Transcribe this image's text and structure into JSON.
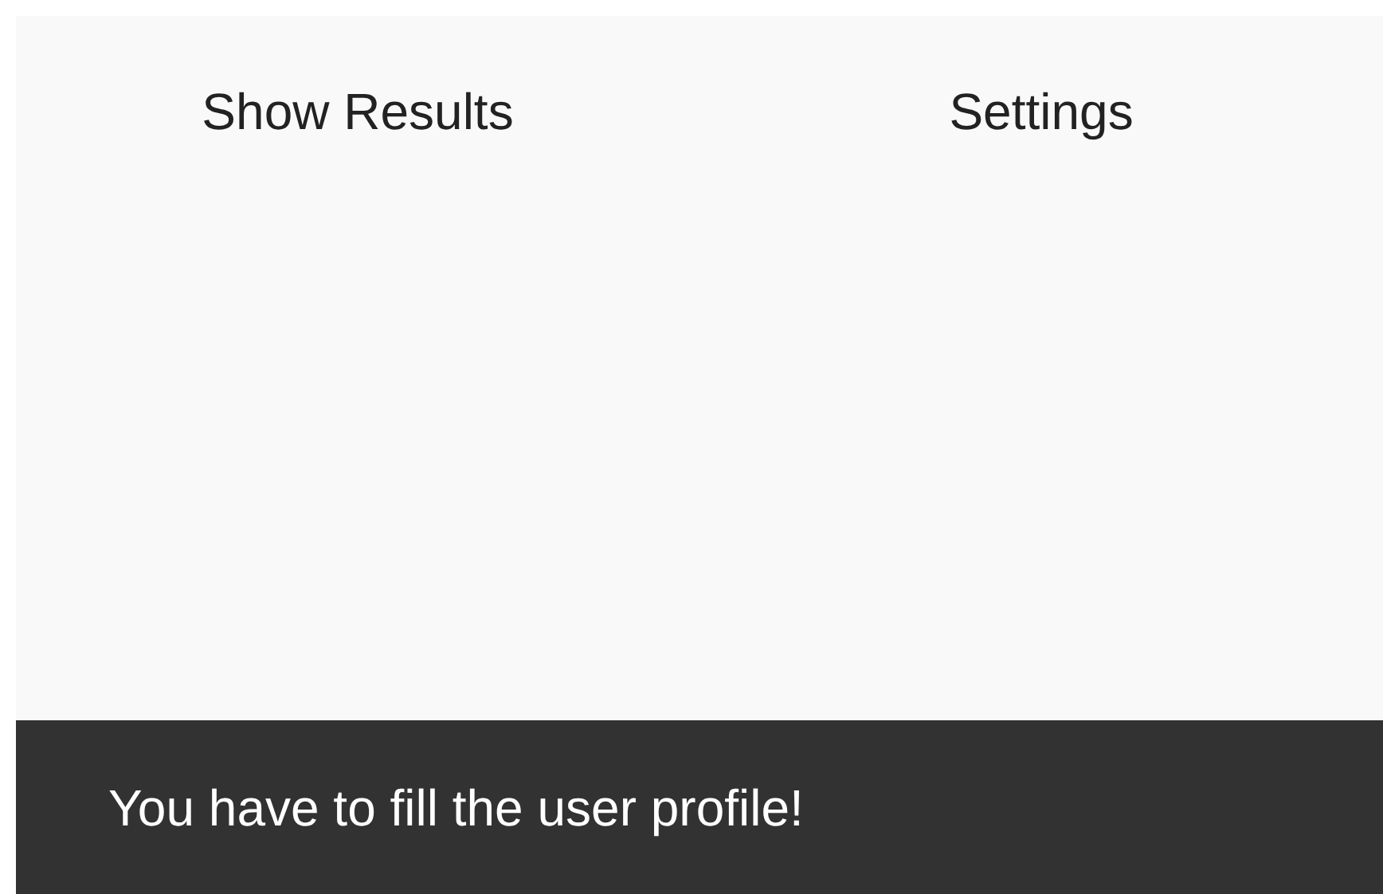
{
  "buttons": [
    {
      "label": "Show Results"
    },
    {
      "label": "Settings"
    }
  ],
  "snackbar": {
    "message": "You have to fill the user profile!"
  }
}
